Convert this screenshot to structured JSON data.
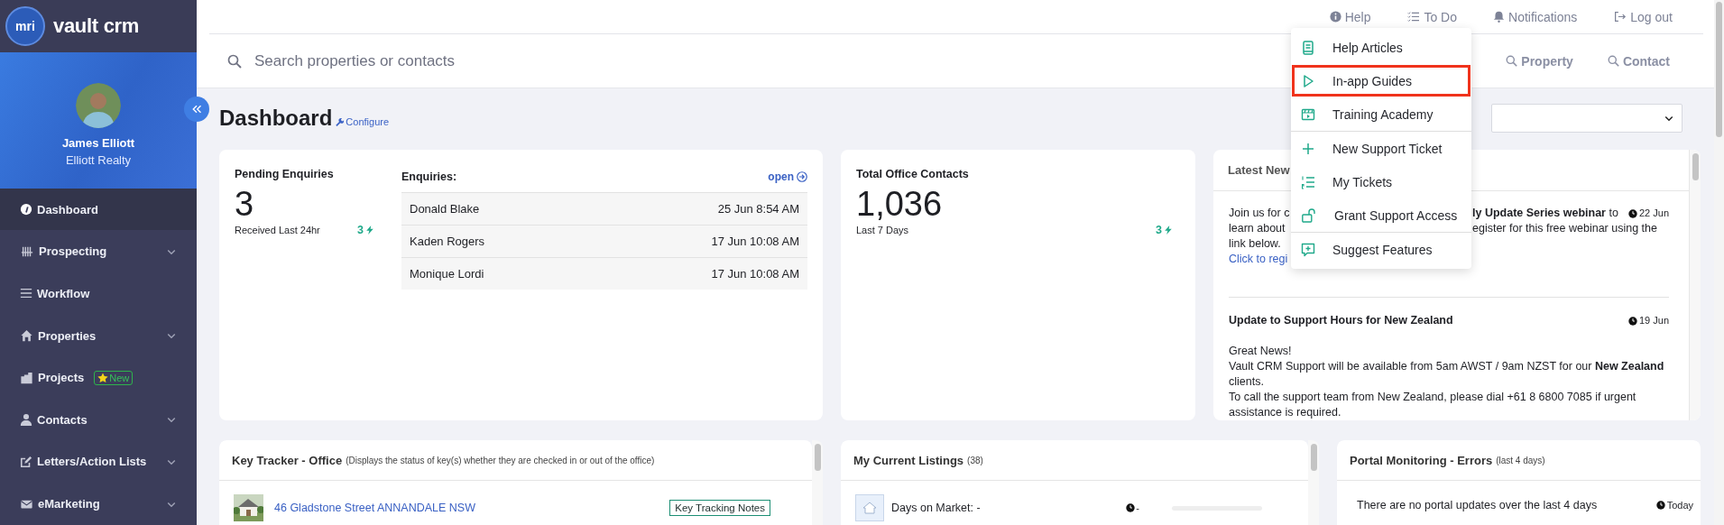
{
  "sidebar": {
    "logo": {
      "mark": "mri",
      "name": "vault crm"
    },
    "user": {
      "name": "James Elliott",
      "company": "Elliott Realty"
    },
    "nav": [
      {
        "label": "Dashboard",
        "selected": true,
        "expandable": false
      },
      {
        "label": "Prospecting",
        "selected": false,
        "expandable": true
      },
      {
        "label": "Workflow",
        "selected": false,
        "expandable": false
      },
      {
        "label": "Properties",
        "selected": false,
        "expandable": true
      },
      {
        "label": "Projects",
        "selected": false,
        "expandable": false,
        "badge": "New"
      },
      {
        "label": "Contacts",
        "selected": false,
        "expandable": true
      },
      {
        "label": "Letters/Action Lists",
        "selected": false,
        "expandable": true
      },
      {
        "label": "eMarketing",
        "selected": false,
        "expandable": true
      }
    ]
  },
  "top_links": [
    {
      "label": "Help"
    },
    {
      "label": "To Do"
    },
    {
      "label": "Notifications"
    },
    {
      "label": "Log out"
    }
  ],
  "help_menu": {
    "groups": [
      [
        {
          "label": "Help Articles",
          "highlighted": false
        },
        {
          "label": "In-app Guides",
          "highlighted": true
        },
        {
          "label": "Training Academy",
          "highlighted": false
        }
      ],
      [
        {
          "label": "New Support Ticket",
          "highlighted": false
        },
        {
          "label": "My Tickets",
          "highlighted": false
        },
        {
          "label": "Grant Support Access",
          "highlighted": false
        }
      ],
      [
        {
          "label": "Suggest Features",
          "highlighted": false
        }
      ]
    ]
  },
  "search": {
    "placeholder": "Search properties or contacts",
    "scopes": [
      "Property",
      "Contact"
    ]
  },
  "page": {
    "title": "Dashboard",
    "configure": "Configure"
  },
  "pending": {
    "title": "Pending Enquiries",
    "count": "3",
    "caption": "Received Last 24hr",
    "new_count": "3",
    "list_title": "Enquiries:",
    "open_link": "open",
    "rows": [
      {
        "name": "Donald Blake",
        "time": "25 Jun 8:54 AM"
      },
      {
        "name": "Kaden Rogers",
        "time": "17 Jun 10:08 AM"
      },
      {
        "name": "Monique Lordi",
        "time": "17 Jun 10:08 AM"
      }
    ]
  },
  "contacts": {
    "title": "Total Office Contacts",
    "count": "1,036",
    "caption": "Last 7 Days",
    "new_count": "3"
  },
  "news": {
    "title": "Latest New",
    "items": [
      {
        "kind": "covered",
        "left_lines": [
          "Join us for c",
          "learn about",
          "link below."
        ],
        "left_link": "Click to regi",
        "right_lines": [
          "**ly Update Series webinar** to",
          "egister for this free webinar using the"
        ],
        "date": "22 Jun"
      },
      {
        "kind": "full",
        "title": "Update to Support Hours for New Zealand",
        "date": "19 Jun",
        "lines": [
          "Great News!",
          "Vault CRM Support will be available from 5am AWST / 9am NZST for our **New Zealand** clients.",
          "To call the support team from New Zealand, please dial +61 8 6800 7085 if urgent assistance is required."
        ]
      }
    ]
  },
  "key_tracker": {
    "title": "Key Tracker - Office",
    "subtitle": "(Displays the status of key(s) whether they are checked in or out of the office)",
    "rows": [
      {
        "address": "46 Gladstone Street ANNANDALE NSW",
        "action": "Key Tracking Notes"
      }
    ]
  },
  "listings": {
    "title": "My Current Listings",
    "count": "(38)",
    "rows": [
      {
        "label": "Days on Market: -",
        "time": "-",
        "level": 0
      }
    ]
  },
  "portal": {
    "title": "Portal Monitoring - Errors",
    "subtitle": "(last 4 days)",
    "rows": [
      {
        "message": "There are no portal updates over the last 4 days",
        "time": "Today"
      }
    ]
  }
}
